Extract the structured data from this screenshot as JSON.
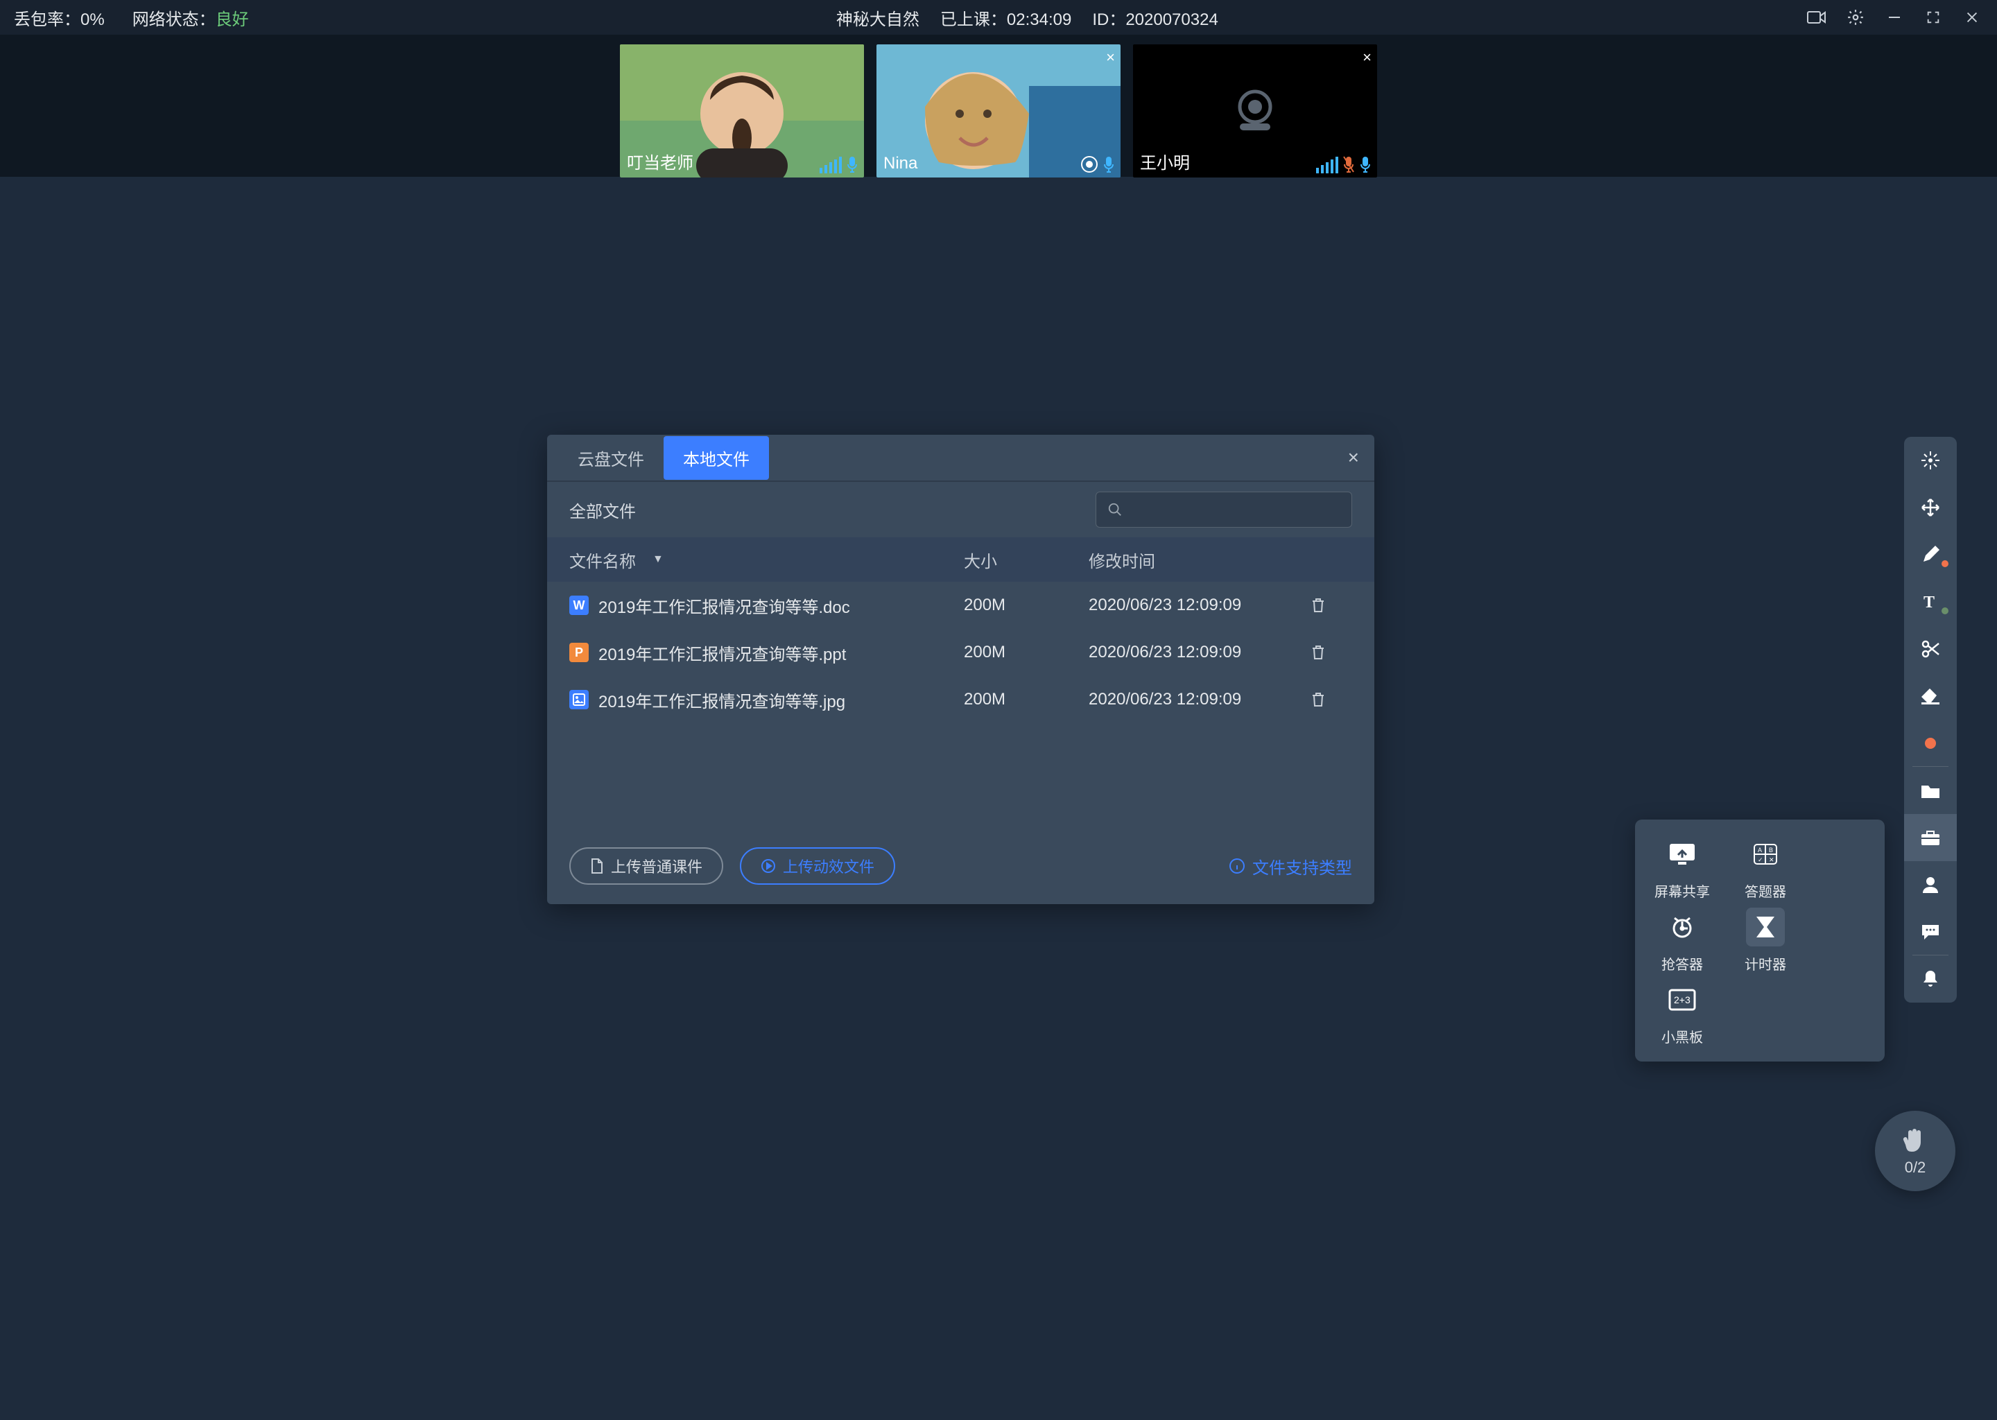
{
  "statusbar": {
    "loss_label": "丢包率：",
    "loss_value": "0%",
    "net_label": "网络状态：",
    "net_value": "良好",
    "class_name": "神秘大自然",
    "elapsed_label": "已上课：",
    "elapsed_value": "02:34:09",
    "id_label": "ID：",
    "id_value": "2020070324"
  },
  "participants": [
    {
      "name": "叮当老师",
      "camera_on": true,
      "mic_color": "#3FB6FF",
      "mic_muted": false,
      "closeable": false
    },
    {
      "name": "Nina",
      "camera_on": true,
      "mic_color": "#3FB6FF",
      "mic_muted": false,
      "closeable": true
    },
    {
      "name": "王小明",
      "camera_on": false,
      "mic_color": "#3FB6FF",
      "mic_muted": true,
      "closeable": true
    }
  ],
  "dialog": {
    "tabs": {
      "cloud": "云盘文件",
      "local": "本地文件"
    },
    "active_tab": "local",
    "breadcrumb": "全部文件",
    "columns": {
      "name": "文件名称",
      "size": "大小",
      "time": "修改时间"
    },
    "files": [
      {
        "icon": "doc",
        "name": "2019年工作汇报情况查询等等.doc",
        "size": "200M",
        "time": "2020/06/23 12:09:09"
      },
      {
        "icon": "ppt",
        "name": "2019年工作汇报情况查询等等.ppt",
        "size": "200M",
        "time": "2020/06/23 12:09:09"
      },
      {
        "icon": "jpg",
        "name": "2019年工作汇报情况查询等等.jpg",
        "size": "200M",
        "time": "2020/06/23 12:09:09"
      }
    ],
    "upload_normal": "上传普通课件",
    "upload_dynamic": "上传动效文件",
    "help": "文件支持类型"
  },
  "tool_panel": {
    "screen_share": "屏幕共享",
    "answer": "答题器",
    "buzzer": "抢答器",
    "timer": "计时器",
    "board": "小黑板"
  },
  "side_tools": {
    "laser": "laser-pointer",
    "move": "move-tool",
    "pen": "pen-tool",
    "text": "text-tool",
    "scissors": "snip-tool",
    "eraser": "eraser-tool",
    "color": "color-dot",
    "folder": "courseware",
    "toolbox": "toolbox",
    "roster": "roster",
    "chat": "chat",
    "bell": "notification"
  },
  "raise_hand": {
    "count": "0/2"
  }
}
